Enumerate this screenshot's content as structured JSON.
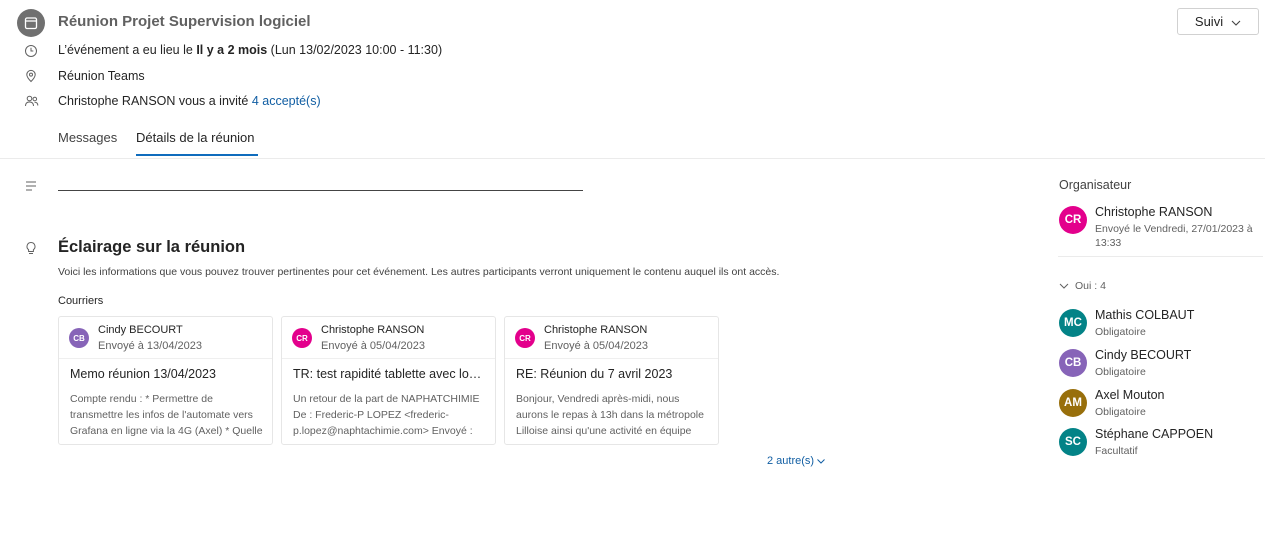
{
  "event": {
    "title": "Réunion Projet Supervision logiciel",
    "time_prefix": "L’événement a eu lieu le",
    "time_relative": "Il y a 2 mois",
    "time_detail": "(Lun 13/02/2023 10:00 - 11:30)",
    "location": "Réunion Teams",
    "invite_text": "Christophe RANSON vous a invité",
    "accepted_link": "4 accepté(s)"
  },
  "follow_button": {
    "label": "Suivi"
  },
  "tabs": [
    {
      "label": "Messages",
      "active": false
    },
    {
      "label": "Détails de la réunion",
      "active": true
    }
  ],
  "insights": {
    "title": "Éclairage sur la réunion",
    "description": "Voici les informations que vous pouvez trouver pertinentes pour cet événement. Les autres participants verront uniquement le contenu auquel ils ont accès.",
    "mail_label": "Courriers",
    "mails": [
      {
        "initials": "CB",
        "avatar_color": "#8764b8",
        "sender": "Cindy BECOURT",
        "date": "Envoyé à 13/04/2023",
        "subject": "Memo réunion 13/04/2023",
        "preview": "Compte rendu : * Permettre de transmettre les infos de l'automate vers Grafana en ligne via la 4G (Axel) * Quelle"
      },
      {
        "initials": "CR",
        "avatar_color": "#e3008c",
        "sender": "Christophe RANSON",
        "date": "Envoyé à 05/04/2023",
        "subject": "TR: test rapidité tablette avec log...",
        "preview": "Un retour de la part de NAPHATCHIMIE De : Frederic-P LOPEZ <frederic-p.lopez@naphtachimie.com> Envoyé :"
      },
      {
        "initials": "CR",
        "avatar_color": "#e3008c",
        "sender": "Christophe RANSON",
        "date": "Envoyé à 05/04/2023",
        "subject": "RE: Réunion du 7 avril 2023",
        "preview": "Bonjour, Vendredi après-midi, nous aurons le repas à 13h dans la métropole Lilloise ainsi qu'une activité en équipe"
      }
    ],
    "more_link": "2 autre(s)"
  },
  "organizer": {
    "label": "Organisateur",
    "initials": "CR",
    "avatar_color": "#e3008c",
    "name": "Christophe RANSON",
    "sent": "Envoyé le Vendredi, 27/01/2023 à 13:33"
  },
  "attendees": {
    "group_label": "Oui : 4",
    "people": [
      {
        "initials": "MC",
        "avatar_color": "#038387",
        "name": "Mathis COLBAUT",
        "role": "Obligatoire"
      },
      {
        "initials": "CB",
        "avatar_color": "#8764b8",
        "name": "Cindy BECOURT",
        "role": "Obligatoire"
      },
      {
        "initials": "AM",
        "avatar_color": "#986f0b",
        "name": "Axel Mouton",
        "role": "Obligatoire"
      },
      {
        "initials": "SC",
        "avatar_color": "#038387",
        "name": "Stéphane CAPPOEN",
        "role": "Facultatif"
      }
    ]
  }
}
